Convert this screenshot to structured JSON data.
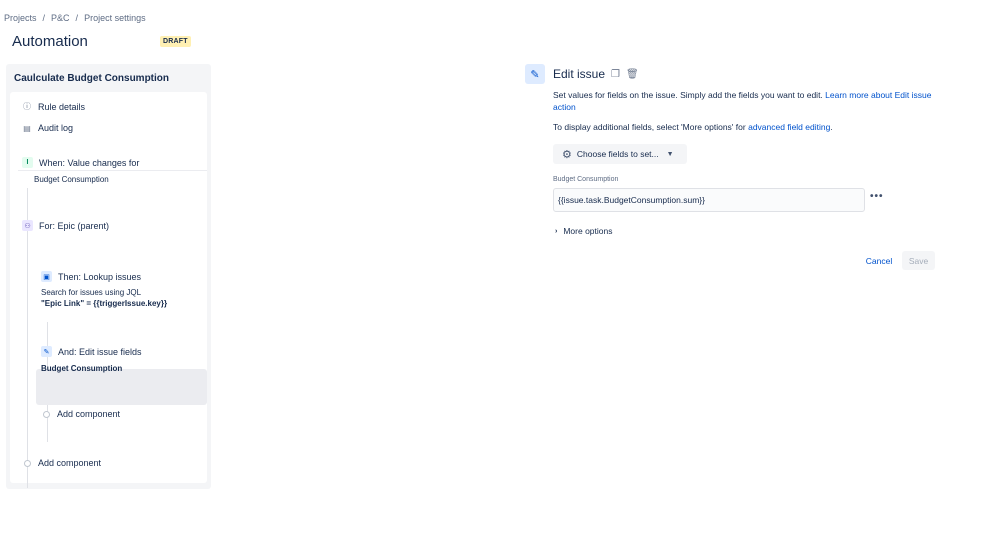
{
  "breadcrumb": {
    "items": [
      "Projects",
      "P&C",
      "Project settings"
    ],
    "separator": "/"
  },
  "page": {
    "title": "Automation",
    "status_badge": "DRAFT"
  },
  "rule": {
    "name": "Caulculate Budget Consumption",
    "meta": [
      {
        "label": "Rule details",
        "icon": "info-icon"
      },
      {
        "label": "Audit log",
        "icon": "log-icon"
      }
    ],
    "trigger": {
      "title": "When: Value changes for",
      "sub": "Budget Consumption",
      "icon": "trigger-icon"
    },
    "branch": {
      "title": "For: Epic (parent)",
      "icon": "branch-icon"
    },
    "lookup": {
      "title": "Then: Lookup issues",
      "sub": "Search for issues using JQL",
      "sub2": "\"Epic Link\" = {{triggerIssue.key}}",
      "icon": "lookup-icon"
    },
    "edit": {
      "title": "And: Edit issue fields",
      "sub": "Budget Consumption",
      "icon": "pencil-icon"
    },
    "add_component_inner": "Add component",
    "add_component_outer": "Add component"
  },
  "editor": {
    "title": "Edit issue",
    "description": "Set values for fields on the issue. Simply add the fields you want to edit.",
    "learn_more_link": "Learn more about Edit issue action",
    "additional_prefix": "To display additional fields, select 'More options' for",
    "additional_link": "advanced field editing",
    "additional_suffix": ".",
    "choose_button": "Choose fields to set...",
    "field_label": "Budget Consumption",
    "field_value": "{{issue.task.BudgetConsumption.sum}}",
    "more_options": "More options",
    "cancel": "Cancel",
    "save": "Save"
  },
  "colors": {
    "link": "#0052cc",
    "draft_bg": "#fff0b3",
    "panel_bg": "#f4f5f7"
  }
}
